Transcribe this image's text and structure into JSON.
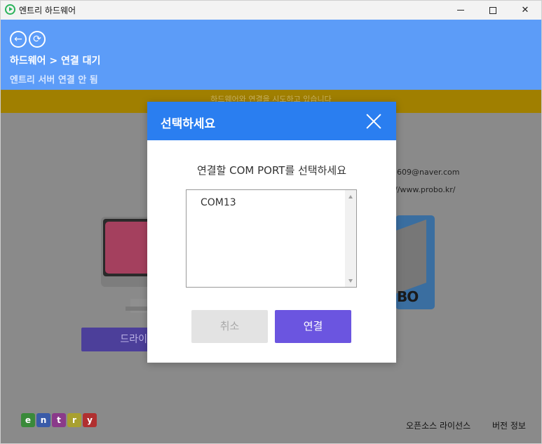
{
  "window": {
    "title": "엔트리 하드웨어",
    "controls": {
      "minimize": "minimize",
      "maximize": "maximize",
      "close": "✕"
    }
  },
  "header": {
    "breadcrumb": "하드웨어 > 연결 대기",
    "status": "엔트리 서버 연결 안 됨",
    "back_icon": "←",
    "refresh_icon": "⟳"
  },
  "banner": {
    "text": "하드웨어와 연결을 시도하고 있습니다"
  },
  "main": {
    "email": "5609@naver.com",
    "url": "//www.probo.kr/",
    "robot_label": "BO",
    "driver_button_label": "드라이"
  },
  "footer": {
    "logo_letters": [
      "e",
      "n",
      "t",
      "r",
      "y"
    ],
    "license_label": "오픈소스 라이선스",
    "version_label": "버전 정보"
  },
  "modal": {
    "title": "선택하세요",
    "prompt": "연결할 COM PORT를 선택하세요",
    "ports": [
      "COM13"
    ],
    "cancel_label": "취소",
    "connect_label": "연결"
  },
  "colors": {
    "header_bg": "#5c9cf8",
    "banner_bg": "#a07f00",
    "modal_header_bg": "#2a7ef0",
    "connect_button_bg": "#6b55e0",
    "overlay_bg": "#8a8a8a"
  }
}
